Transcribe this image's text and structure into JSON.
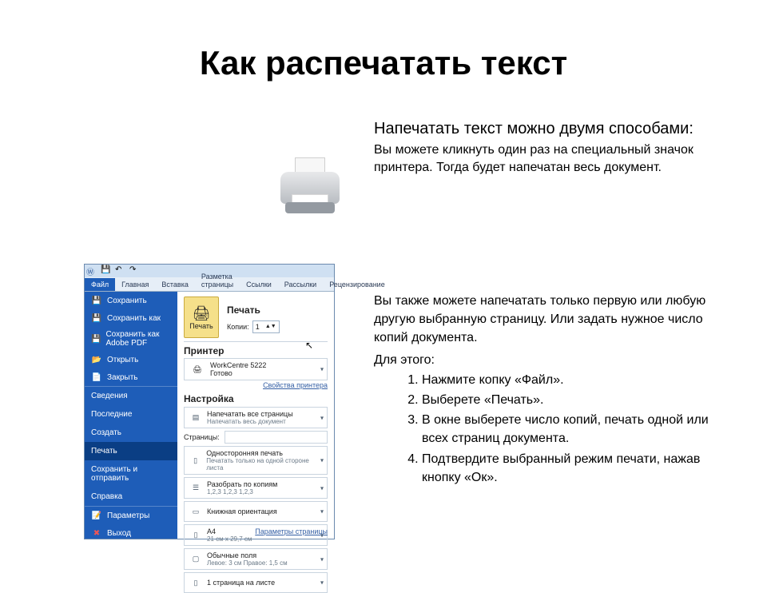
{
  "title": "Как распечатать текст",
  "section1": {
    "intro": "Напечатать текст можно двумя способами:",
    "body": "Вы можете кликнуть один раз на специальный значок принтера. Тогда будет напечатан весь документ."
  },
  "section2": {
    "para": "Вы также можете напечатать только первую или любую другую выбранную страницу. Или задать нужное число копий документа.",
    "for_this": "Для этого:",
    "steps": [
      "Нажмите копку «Файл».",
      "Выберете «Печать».",
      "В окне выберете число копий, печать одной или всех страниц документа.",
      "Подтвердите выбранный режим печати, нажав кнопку «Ок»."
    ]
  },
  "word": {
    "tabs": [
      "Файл",
      "Главная",
      "Вставка",
      "Разметка страницы",
      "Ссылки",
      "Рассылки",
      "Рецензирование"
    ],
    "sidebar_top": [
      {
        "label": "Сохранить",
        "icon": "💾"
      },
      {
        "label": "Сохранить как",
        "icon": "💾"
      },
      {
        "label": "Сохранить как Adobe PDF",
        "icon": "💾"
      },
      {
        "label": "Открыть",
        "icon": "📂"
      },
      {
        "label": "Закрыть",
        "icon": "📄"
      }
    ],
    "sidebar_mid": [
      "Сведения",
      "Последние",
      "Создать",
      "Печать",
      "Сохранить и отправить",
      "Справка"
    ],
    "sidebar_active": "Печать",
    "sidebar_bottom": [
      {
        "label": "Параметры",
        "icon": "⚙"
      },
      {
        "label": "Выход",
        "icon": "✖"
      }
    ],
    "pane": {
      "header_title": "Печать",
      "print_button": "Печать",
      "copies_label": "Копии:",
      "copies_value": "1",
      "printer_title": "Принтер",
      "printer_name": "WorkCentre 5222",
      "printer_status": "Готово",
      "printer_props": "Свойства принтера",
      "settings_title": "Настройка",
      "opt_all_pages": "Напечатать все страницы",
      "opt_all_pages_sub": "Напечатать весь документ",
      "pages_label": "Страницы:",
      "opt_single_side": "Односторонняя печать",
      "opt_single_side_sub": "Печатать только на одной стороне листа",
      "opt_collate": "Разобрать по копиям",
      "opt_collate_sub": "1,2,3   1,2,3   1,2,3",
      "opt_orient": "Книжная ориентация",
      "opt_paper": "A4",
      "opt_paper_sub": "21 см x 29,7 см",
      "opt_margins": "Обычные поля",
      "opt_margins_sub": "Левое: 3 см   Правое: 1,5 см",
      "opt_per_sheet": "1 страница на листе",
      "page_setup_link": "Параметры страницы"
    }
  }
}
